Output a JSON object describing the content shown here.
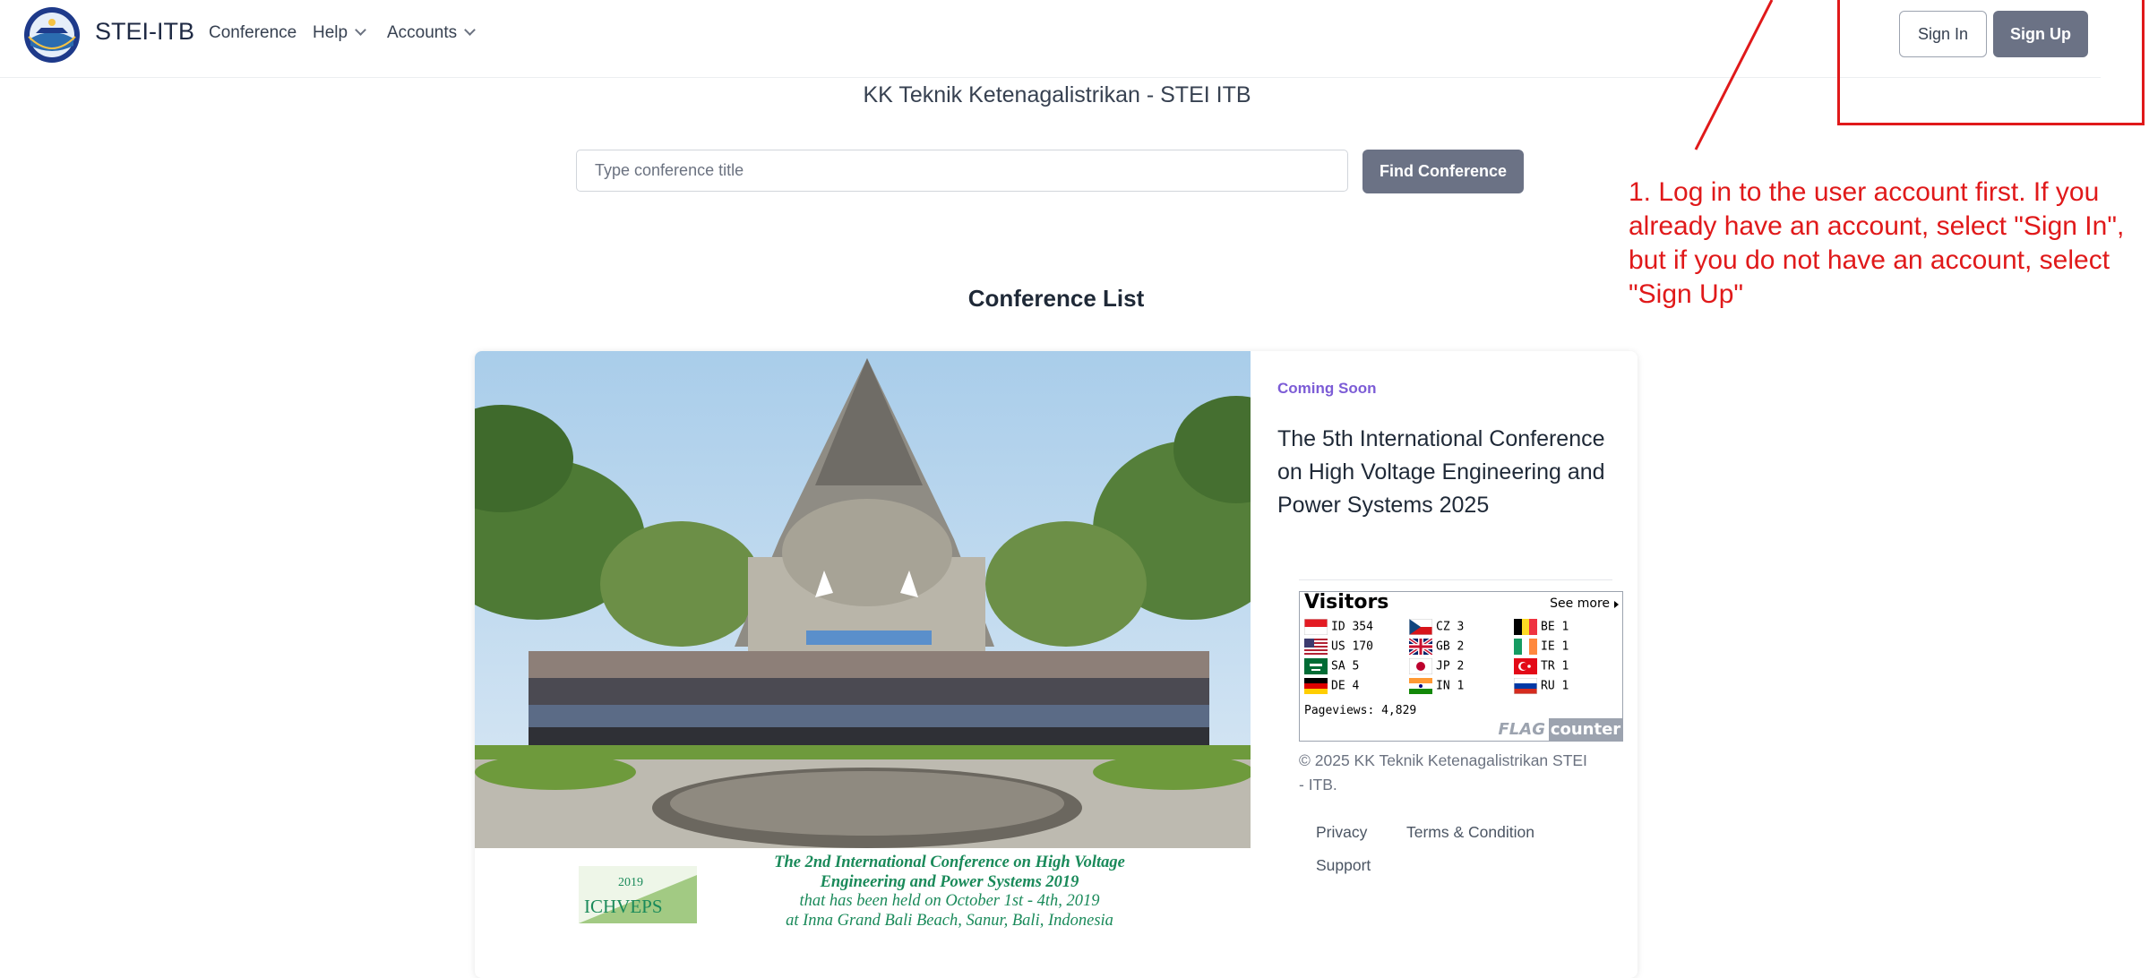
{
  "header": {
    "brand": "STEI-ITB",
    "nav": [
      {
        "label": "Conference"
      },
      {
        "label": "Help"
      },
      {
        "label": "Accounts"
      }
    ],
    "sign_in": "Sign In",
    "sign_up": "Sign Up"
  },
  "annotation": {
    "text": "1. Log in to the user account first. If you already have an account, select \"Sign In\", but if you do not have an account, select \"Sign Up\"",
    "color": "#e0191a"
  },
  "page": {
    "title": "KK Teknik Ketenagalistrikan - STEI ITB",
    "search_placeholder": "Type conference title",
    "search_value": "",
    "find_button": "Find Conference",
    "section_title": "Conference List"
  },
  "conference": {
    "badge": "Coming Soon",
    "title": "The 5th International Conference on High Voltage Engineering and Power Systems 2025",
    "caption": {
      "logo_year": "2019",
      "logo_text": "ICHVEPS",
      "line1": "The 2nd International Conference on High Voltage",
      "line2": "Engineering and Power Systems 2019",
      "line3": "that has been held on October 1st - 4th, 2019",
      "line4": "at Inna Grand Bali Beach, Sanur, Bali, Indonesia"
    }
  },
  "flag_counter": {
    "title": "Visitors",
    "see_more": "See more",
    "entries": [
      {
        "code": "ID",
        "count": "354"
      },
      {
        "code": "US",
        "count": "170"
      },
      {
        "code": "SA",
        "count": "5"
      },
      {
        "code": "DE",
        "count": "4"
      },
      {
        "code": "CZ",
        "count": "3"
      },
      {
        "code": "GB",
        "count": "2"
      },
      {
        "code": "JP",
        "count": "2"
      },
      {
        "code": "IN",
        "count": "1"
      },
      {
        "code": "BE",
        "count": "1"
      },
      {
        "code": "IE",
        "count": "1"
      },
      {
        "code": "TR",
        "count": "1"
      },
      {
        "code": "RU",
        "count": "1"
      }
    ],
    "pageviews": "Pageviews: 4,829",
    "logo_flag": "FLAG",
    "logo_counter": "counter"
  },
  "footer": {
    "copyright": "© 2025 KK Teknik Ketenagalistrikan STEI - ITB.",
    "links": [
      {
        "label": "Privacy"
      },
      {
        "label": "Terms & Condition"
      },
      {
        "label": "Support"
      }
    ]
  },
  "colors": {
    "primary_button": "#6b7285",
    "badge": "#7c5cd6",
    "annotation_red": "#e0191a"
  }
}
